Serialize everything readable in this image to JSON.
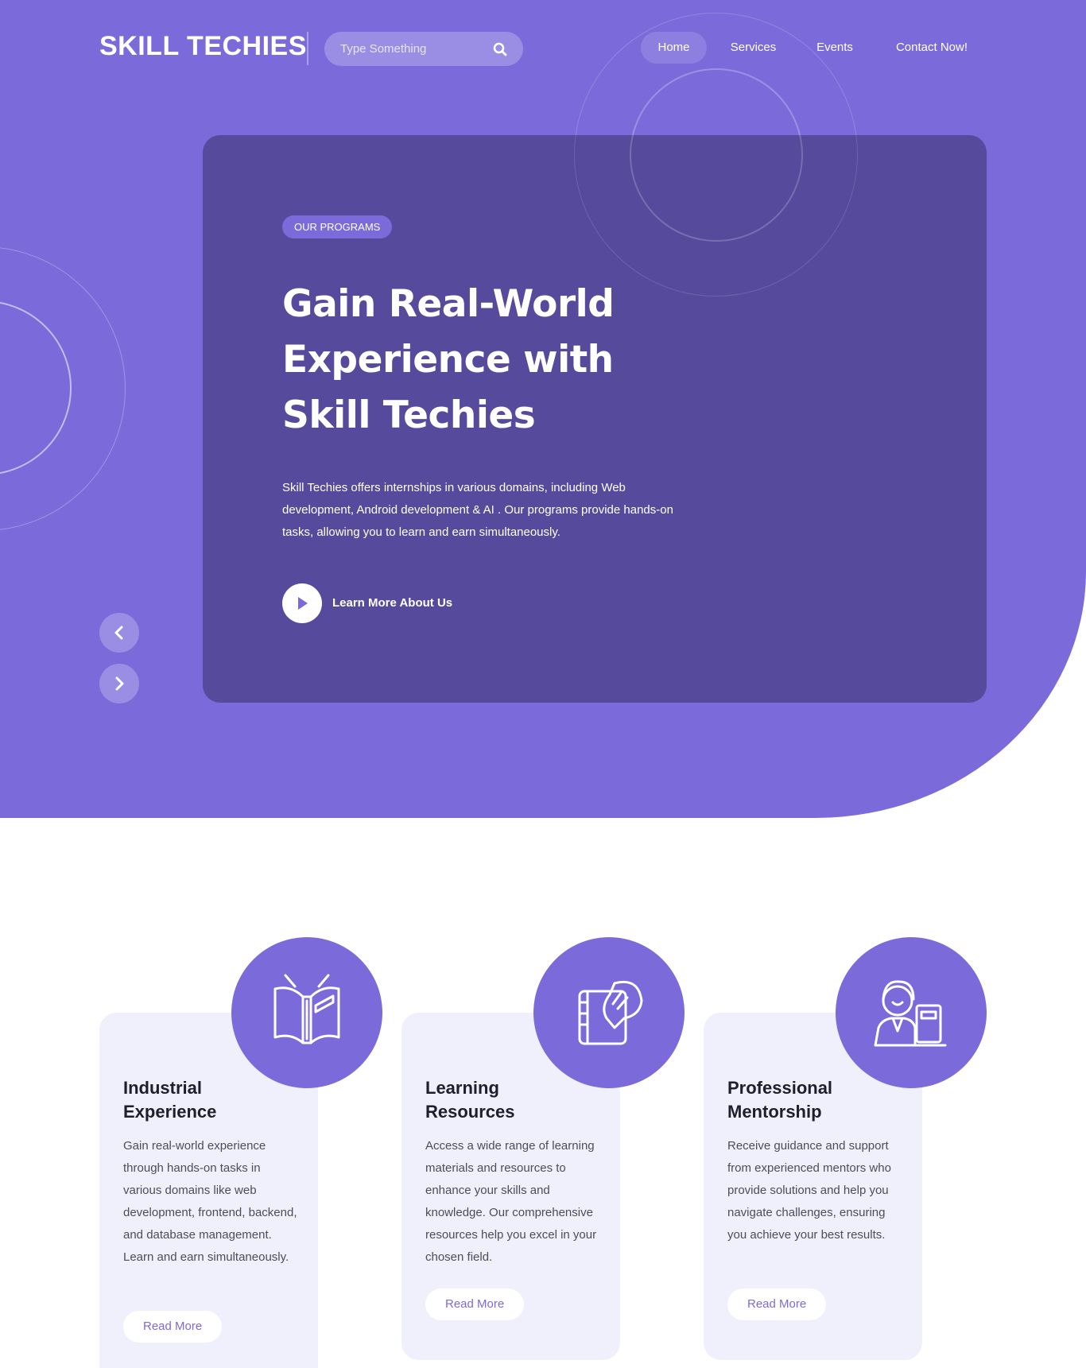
{
  "header": {
    "logo": "SKILL TECHIES",
    "search_placeholder": "Type Something",
    "nav": [
      {
        "label": "Home",
        "active": true
      },
      {
        "label": "Services",
        "active": false
      },
      {
        "label": "Events",
        "active": false
      },
      {
        "label": "Contact Now!",
        "active": false
      }
    ]
  },
  "hero": {
    "badge": "OUR PROGRAMS",
    "title_lines": [
      "Gain Real-World",
      "Experience with",
      "Skill Techies"
    ],
    "description": "Skill Techies offers internships in various domains, including Web development, Android development & AI . Our programs provide hands-on tasks, allowing you to learn and earn simultaneously.",
    "cta_label": "Learn More About Us",
    "icons": {
      "play": "play-icon",
      "prev": "chevron-left-icon",
      "next": "chevron-right-icon"
    }
  },
  "features": [
    {
      "icon": "open-book-icon",
      "title_lines": [
        "Industrial",
        "Experience"
      ],
      "text": "Gain real-world experience through hands-on tasks in various domains like web development, frontend, backend, and database management. Learn and earn simultaneously.",
      "button": "Read More"
    },
    {
      "icon": "book-hand-icon",
      "title_lines": [
        "Learning",
        "Resources"
      ],
      "text": "Access a wide range of learning materials and resources to enhance your skills and knowledge. Our comprehensive resources help you excel in your chosen field.",
      "button": "Read More"
    },
    {
      "icon": "mentor-icon",
      "title_lines": [
        "Professional",
        "Mentorship"
      ],
      "text": "Receive guidance and support from experienced mentors who provide solutions and help you navigate challenges, ensuring you achieve your best results.",
      "button": "Read More"
    }
  ],
  "colors": {
    "primary": "#7b6bda",
    "hero_card": "#564a9c",
    "card_bg": "#f0effc",
    "text_dark": "#1f1f2b"
  }
}
